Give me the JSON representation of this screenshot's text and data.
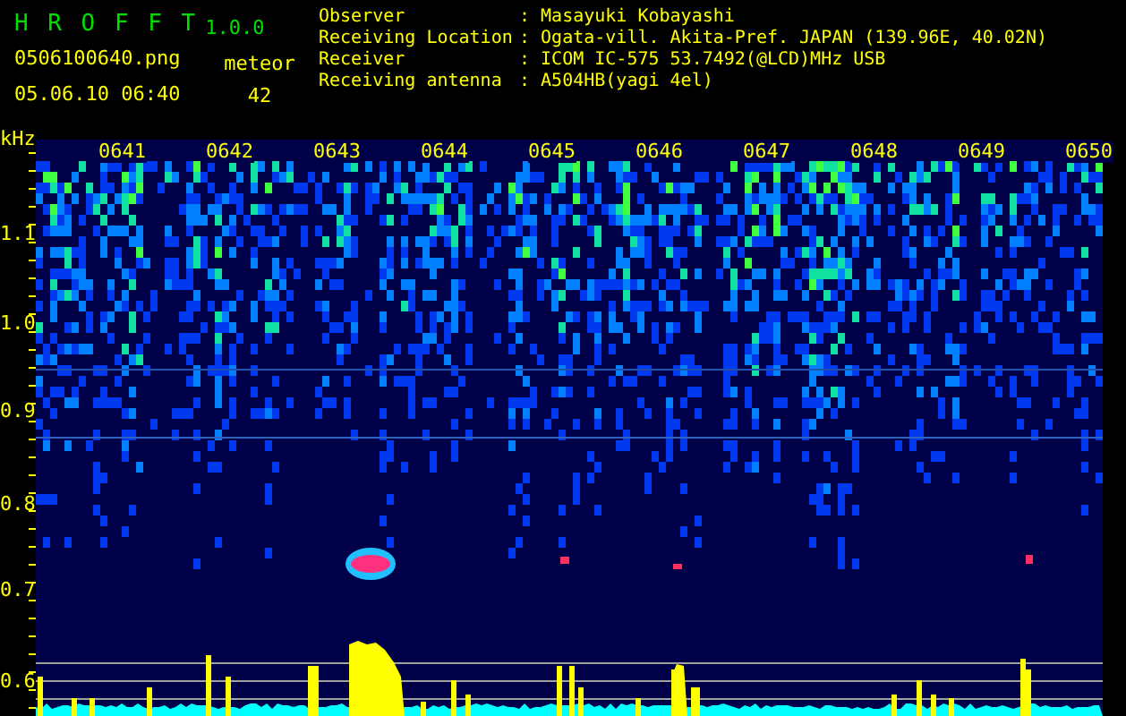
{
  "app": {
    "name": "H R O F F T",
    "version": "1.0.0"
  },
  "file": {
    "name": "0506100640.png",
    "datetime": "05.06.10 06:40"
  },
  "meteor": {
    "label": "meteor",
    "count": "42"
  },
  "info": [
    {
      "label": "Observer",
      "separator": ":",
      "value": "Masayuki Kobayashi"
    },
    {
      "label": "Receiving Location",
      "separator": ":",
      "value": "Ogata-vill. Akita-Pref. JAPAN (139.96E, 40.02N)"
    },
    {
      "label": "Receiver",
      "separator": ":",
      "value": "ICOM IC-575 53.7492(@LCD)MHz USB"
    },
    {
      "label": "Receiving antenna",
      "separator": ":",
      "value": "A504HB(yagi 4el)"
    }
  ],
  "axis": {
    "unit": "kHz",
    "labels": [
      "1.1",
      "1.0",
      "0.9",
      "0.8",
      "0.7",
      "0.6"
    ]
  },
  "time_labels": [
    "0641",
    "0642",
    "0643",
    "0644",
    "0645",
    "0646",
    "0647",
    "0648",
    "0649",
    "0650"
  ]
}
